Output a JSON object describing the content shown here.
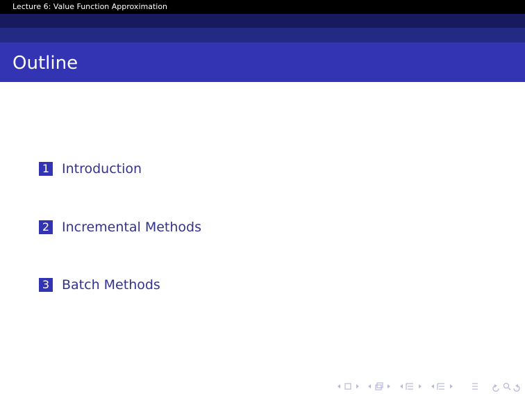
{
  "header": {
    "lecture_title": "Lecture 6: Value Function Approximation"
  },
  "frame": {
    "title": "Outline"
  },
  "toc": {
    "items": [
      {
        "number": "1",
        "label": "Introduction"
      },
      {
        "number": "2",
        "label": "Incremental Methods"
      },
      {
        "number": "3",
        "label": "Batch Methods"
      }
    ]
  },
  "navigation": {
    "symbols": [
      "nav-frame-prev-icon",
      "nav-frame-icon",
      "nav-frame-next-icon",
      "nav-subsection-prev-icon",
      "nav-subsection-icon",
      "nav-subsection-next-icon",
      "nav-section-prev-icon",
      "nav-section-icon",
      "nav-section-next-icon",
      "nav-doc-prev-icon",
      "nav-doc-icon",
      "nav-doc-next-icon",
      "nav-appendix-icon",
      "nav-back-icon",
      "nav-search-icon",
      "nav-forward-icon"
    ]
  },
  "colors": {
    "header_bg": "#000000",
    "band_dark": "#171a5e",
    "band_mid": "#222a84",
    "title_bg": "#3334b4",
    "item_text": "#33338c",
    "nav_symbol": "#b8b8dc"
  }
}
